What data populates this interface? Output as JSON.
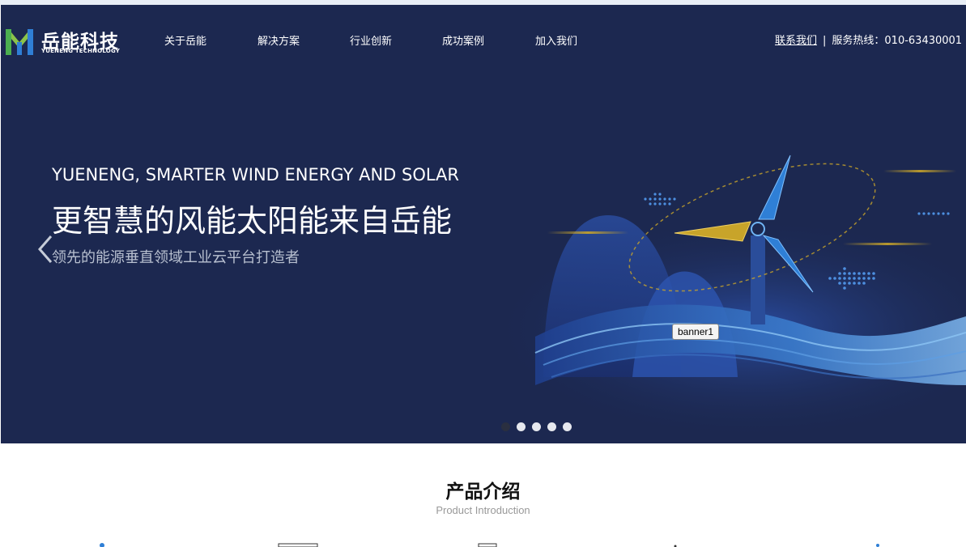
{
  "header": {
    "logo_cn": "岳能科技",
    "logo_en": "YUENENG TECHNOLOGY",
    "nav": [
      {
        "label": "关于岳能"
      },
      {
        "label": "解决方案"
      },
      {
        "label": "行业创新"
      },
      {
        "label": "成功案例"
      },
      {
        "label": "加入我们"
      }
    ],
    "contact_link": "联系我们",
    "separator": "|",
    "hotline": "服务热线：010-63430001"
  },
  "banner": {
    "slogan_en": "YUENENG, SMARTER WIND ENERGY AND SOLAR",
    "slogan_cn": "更智慧的风能太阳能来自岳能",
    "slogan_sub": "领先的能源垂直领域工业云平台打造者",
    "tooltip": "banner1",
    "slides_count": 5,
    "active_slide": 1
  },
  "products": {
    "title": "产品介绍",
    "subtitle": "Product Introduction"
  },
  "colors": {
    "hero_bg": "#1c2850",
    "accent_blue": "#2f7fd6",
    "accent_gold": "#c8a42a",
    "logo_green": "#4caf50"
  }
}
